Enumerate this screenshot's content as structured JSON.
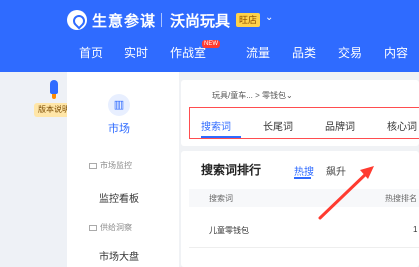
{
  "header": {
    "brand": "生意参谋",
    "shop_name": "沃尚玩具",
    "shop_badge": "旺店",
    "shop_caret": "⌄",
    "nav_badge": "NEW",
    "nav": [
      "首页",
      "实时",
      "作战室",
      "流量",
      "品类",
      "交易",
      "内容"
    ]
  },
  "left_rail": {
    "version_badge": "版本说明"
  },
  "sidebar": {
    "title": "市场",
    "groups": [
      {
        "label": "市场监控",
        "items": [
          "监控看板"
        ]
      },
      {
        "label": "供给洞察",
        "items": [
          "市场大盘"
        ]
      }
    ]
  },
  "main": {
    "breadcrumb": "玩具/童车... > 零钱包⌄",
    "tabs": [
      "搜索词",
      "长尾词",
      "品牌词",
      "核心词"
    ],
    "active_tab": "搜索词",
    "ranking": {
      "title": "搜索词排行",
      "subtabs": [
        "热搜",
        "飙升"
      ],
      "active_subtab": "热搜",
      "columns": [
        "搜索词",
        "热搜排名"
      ],
      "rows": [
        {
          "keyword": "儿童零钱包",
          "rank": "1"
        }
      ]
    }
  },
  "colors": {
    "brand_blue": "#2f6bff",
    "highlight_red": "#ff4d4f",
    "annotation_arrow": "#ff3b30"
  }
}
